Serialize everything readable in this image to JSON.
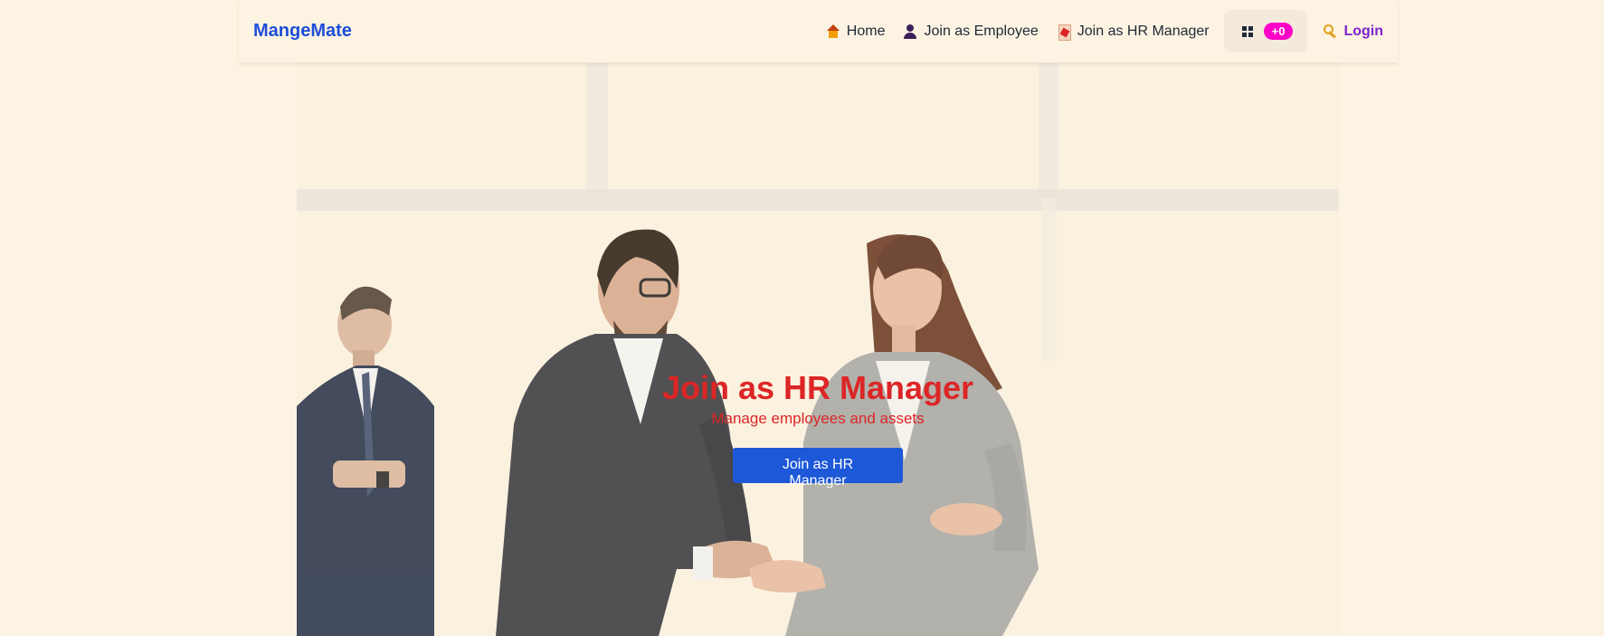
{
  "brand": {
    "name": "MangeMate"
  },
  "nav": {
    "items": [
      {
        "label": "Home",
        "icon": "house-icon"
      },
      {
        "label": "Join as Employee",
        "icon": "user-icon"
      },
      {
        "label": "Join as HR Manager",
        "icon": "document-icon"
      }
    ],
    "dashboard": {
      "icon": "dashboard-grid-icon",
      "badge": "+0"
    },
    "login": {
      "label": "Login",
      "icon": "key-icon"
    }
  },
  "hero": {
    "title": "Join as HR Manager",
    "subtitle": "Manage employees and assets",
    "button_label": "Join as HR Manager",
    "image": "business-handshake-photo"
  },
  "colors": {
    "background": "#fdf3e2",
    "brand": "#1d4ed8",
    "accent_red": "#dc2626",
    "button_blue": "#1d58d8",
    "badge_pink": "#ff00c8",
    "login_purple": "#7e22ce"
  }
}
